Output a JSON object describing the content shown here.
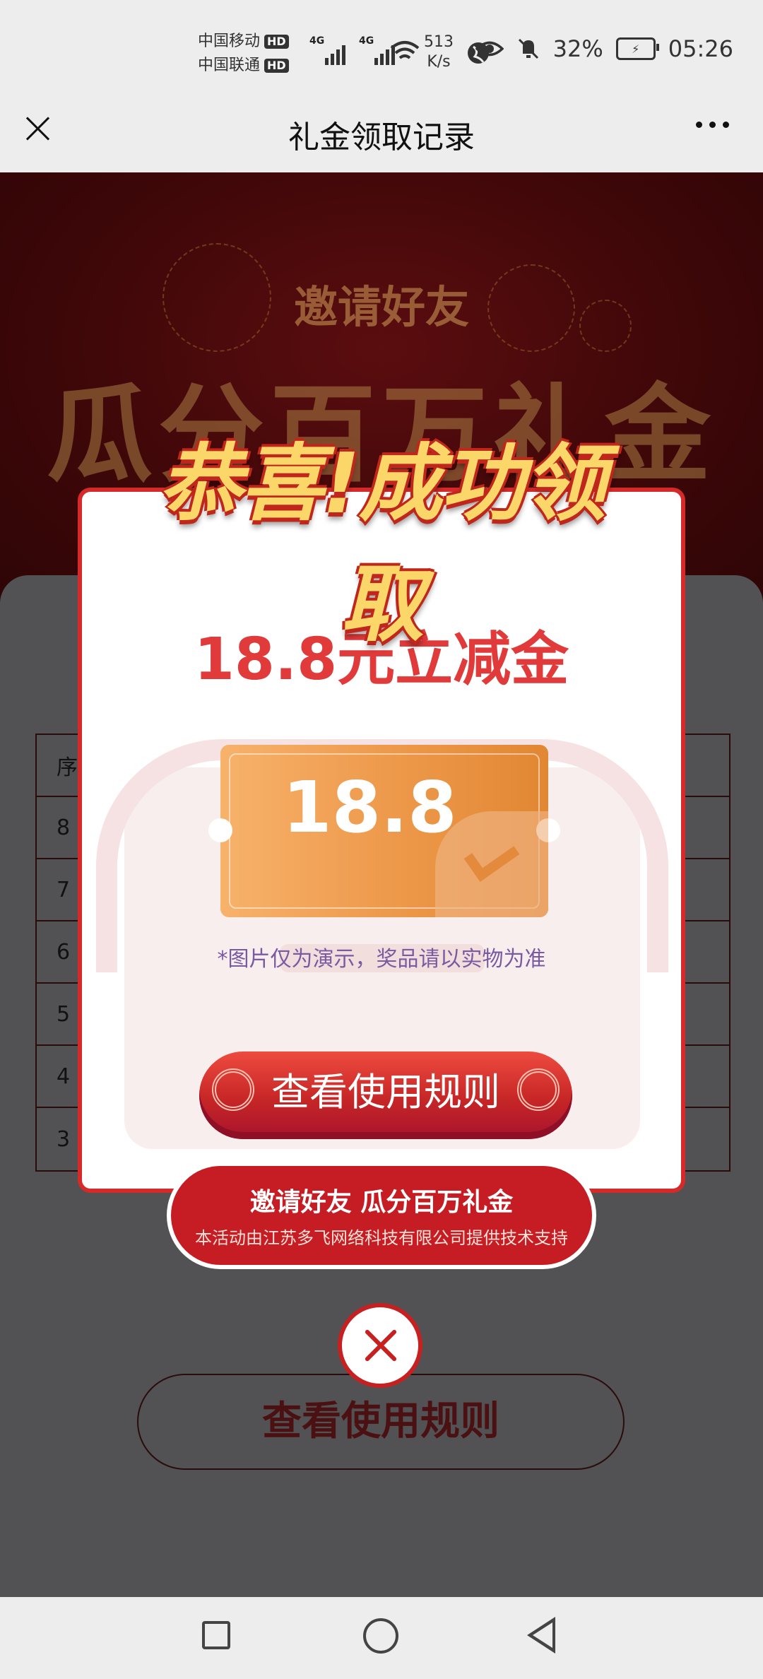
{
  "status_bar": {
    "carrier1": "中国移动",
    "carrier2": "中国联通",
    "hd": "HD",
    "net": "4G",
    "speed_value": "513",
    "speed_unit": "K/s",
    "battery": "32%",
    "time": "05:26"
  },
  "header": {
    "title": "礼金领取记录"
  },
  "background_page": {
    "banner_invite": "邀请好友",
    "banner_title": "瓜分百万礼金",
    "table_header": "序",
    "table_rows": [
      "8",
      "7",
      "6",
      "5",
      "4",
      "3"
    ],
    "rules_button": "查看使用规则"
  },
  "modal": {
    "headline": "恭喜!成功领取",
    "amount_title": "18.8元立减金",
    "coupon_value": "18.8",
    "disclaimer": "*图片仅为演示，奖品请以实物为准",
    "rules_button": "查看使用规则",
    "invite_title": "邀请好友 瓜分百万礼金",
    "invite_subtitle": "本活动由江苏多飞网络科技有限公司提供技术支持"
  },
  "colors": {
    "accent_red": "#d62a2a",
    "coupon_orange": "#ee9a4c",
    "headline_gold": "#fbd76a"
  }
}
